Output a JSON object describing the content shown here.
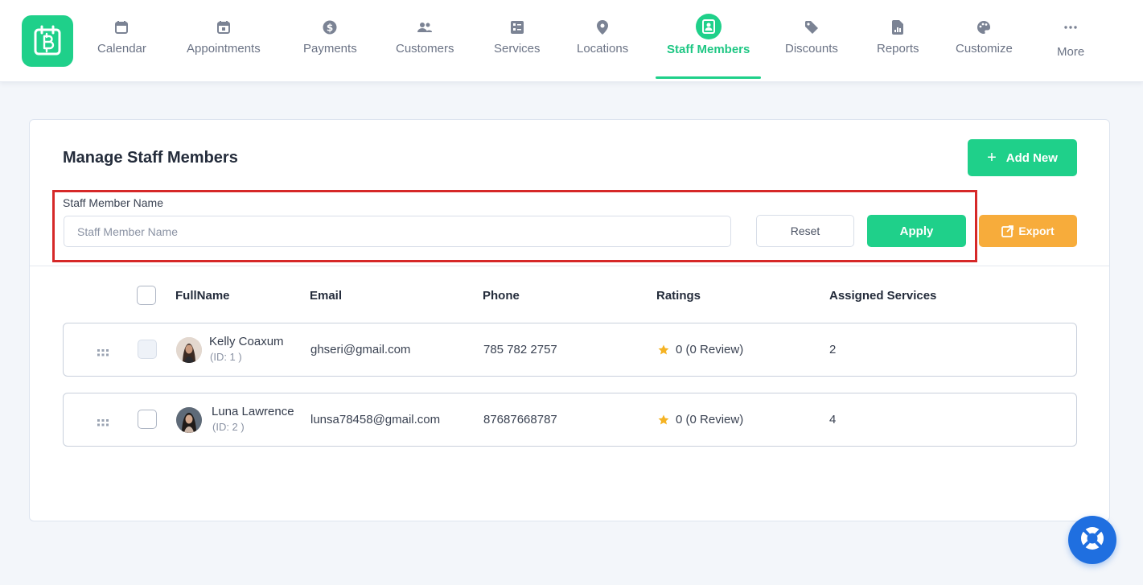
{
  "nav": {
    "items": [
      {
        "label": "Calendar",
        "icon": "calendar-icon"
      },
      {
        "label": "Appointments",
        "icon": "calendar-check-icon"
      },
      {
        "label": "Payments",
        "icon": "dollar-icon"
      },
      {
        "label": "Customers",
        "icon": "users-icon"
      },
      {
        "label": "Services",
        "icon": "services-icon"
      },
      {
        "label": "Locations",
        "icon": "location-pin-icon"
      },
      {
        "label": "Staff Members",
        "icon": "staff-badge-icon",
        "active": true
      },
      {
        "label": "Discounts",
        "icon": "tag-icon"
      },
      {
        "label": "Reports",
        "icon": "report-icon"
      },
      {
        "label": "Customize",
        "icon": "palette-icon"
      },
      {
        "label": "More",
        "icon": "more-dots-icon"
      }
    ]
  },
  "page": {
    "title": "Manage Staff Members",
    "add_new_label": "Add New"
  },
  "filter": {
    "label": "Staff Member Name",
    "placeholder": "Staff Member Name",
    "value": "",
    "reset_label": "Reset",
    "apply_label": "Apply",
    "export_label": "Export"
  },
  "table": {
    "headers": {
      "fullname": "FullName",
      "email": "Email",
      "phone": "Phone",
      "ratings": "Ratings",
      "assigned_services": "Assigned Services"
    },
    "rows": [
      {
        "name": "Kelly Coaxum",
        "id_label": "(ID: 1 )",
        "email": "ghseri@gmail.com",
        "phone": "785 782 2757",
        "rating": "0 (0 Review)",
        "assigned_services": "2"
      },
      {
        "name": "Luna Lawrence",
        "id_label": "(ID: 2 )",
        "email": "lunsa78458@gmail.com",
        "phone": "87687668787",
        "rating": "0 (0 Review)",
        "assigned_services": "4"
      }
    ]
  },
  "colors": {
    "accent": "#1fd08a",
    "export": "#f7ac3b",
    "help": "#1f6fe0",
    "highlight_border": "#d62828",
    "star": "#f5b323"
  }
}
